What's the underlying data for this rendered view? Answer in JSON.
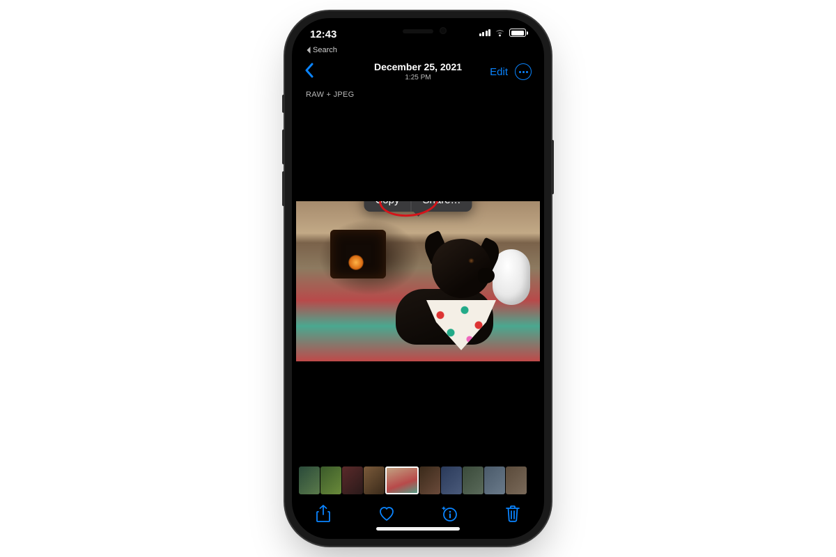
{
  "statusbar": {
    "time": "12:43",
    "breadcrumb_label": "Search"
  },
  "navbar": {
    "date": "December 25, 2021",
    "time": "1:25 PM",
    "edit_label": "Edit"
  },
  "format_badge": "RAW + JPEG",
  "context_menu": {
    "copy_label": "Copy",
    "share_label": "Share…"
  },
  "toolbar": {
    "share_name": "share-icon",
    "favorite_name": "heart-icon",
    "info_name": "info-sparkle-icon",
    "delete_name": "trash-icon"
  },
  "colors": {
    "accent": "#0a84ff",
    "annotation": "#d4141a"
  }
}
